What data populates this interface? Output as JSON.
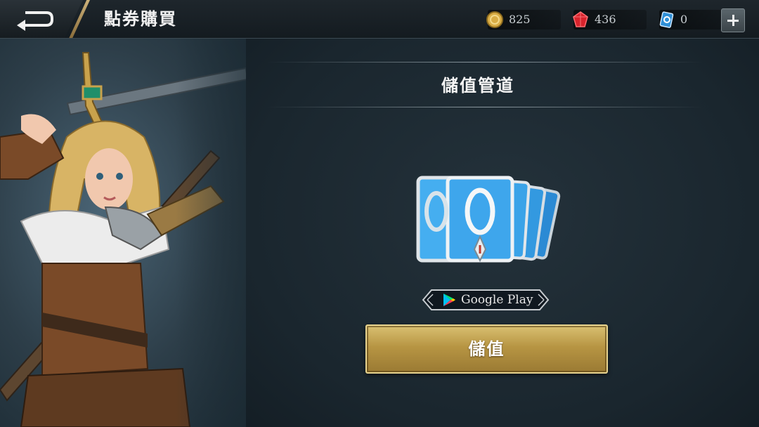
{
  "header": {
    "title": "點券購買",
    "currencies": [
      {
        "name": "gold-coin",
        "value": "825",
        "color": "#e0b84a"
      },
      {
        "name": "ruby",
        "value": "436",
        "color": "#e0262e"
      },
      {
        "name": "voucher",
        "value": "0",
        "color": "#3aa3e6"
      }
    ]
  },
  "main": {
    "section_title": "儲值管道",
    "store_badge": "Google Play",
    "topup_button": "儲值"
  }
}
